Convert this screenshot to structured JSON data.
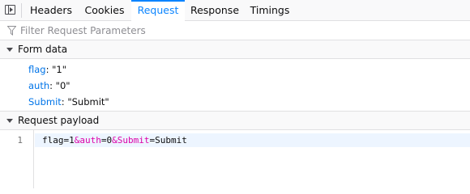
{
  "tabs": {
    "headers": "Headers",
    "cookies": "Cookies",
    "request": "Request",
    "response": "Response",
    "timings": "Timings",
    "selected": "request"
  },
  "filter": {
    "placeholder": "Filter Request Parameters",
    "value": ""
  },
  "form_data": {
    "title": "Form data",
    "params": [
      {
        "key": "flag",
        "value": "\"1\""
      },
      {
        "key": "auth",
        "value": "\"0\""
      },
      {
        "key": "Submit",
        "value": "\"Submit\""
      }
    ]
  },
  "payload": {
    "title": "Request payload",
    "line_number": "1",
    "tokens": [
      {
        "text": "flag=1",
        "kind": "plain"
      },
      {
        "text": "&auth",
        "kind": "amp"
      },
      {
        "text": "=0",
        "kind": "plain"
      },
      {
        "text": "&Submit",
        "kind": "amp"
      },
      {
        "text": "=Submit",
        "kind": "plain"
      }
    ]
  },
  "colors": {
    "accent": "#0a84ff",
    "param_key": "#0074e8",
    "amp_token": "#dd00a9",
    "line_highlight": "#edf5ff"
  },
  "icons": {
    "toggle": "sidebar-toggle-icon",
    "filter": "filter-funnel-icon",
    "twisty": "chevron-down-icon"
  }
}
